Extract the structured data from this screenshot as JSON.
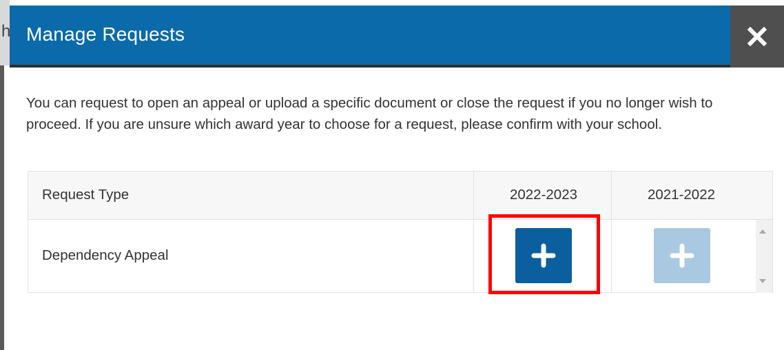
{
  "backdrop": {
    "char": "h"
  },
  "dialog": {
    "title": "Manage Requests",
    "close_icon": "close-icon",
    "intro": "You can request to open an appeal or upload a specific document or close the request if you no longer wish to proceed. If you are unsure which award year to choose for a request, please confirm with your school."
  },
  "table": {
    "headers": [
      "Request Type",
      "2022-2023",
      "2021-2022"
    ],
    "rows": [
      {
        "type": "Dependency Appeal",
        "year_2022_2023": "add-icon",
        "year_2021_2022": "add-icon-disabled"
      }
    ]
  },
  "colors": {
    "header": "#0b6aa9",
    "close_bg": "#4f4f4f",
    "button_active": "#0b5f9e",
    "button_disabled": "#a9c9e2",
    "highlight": "#ff0000"
  }
}
